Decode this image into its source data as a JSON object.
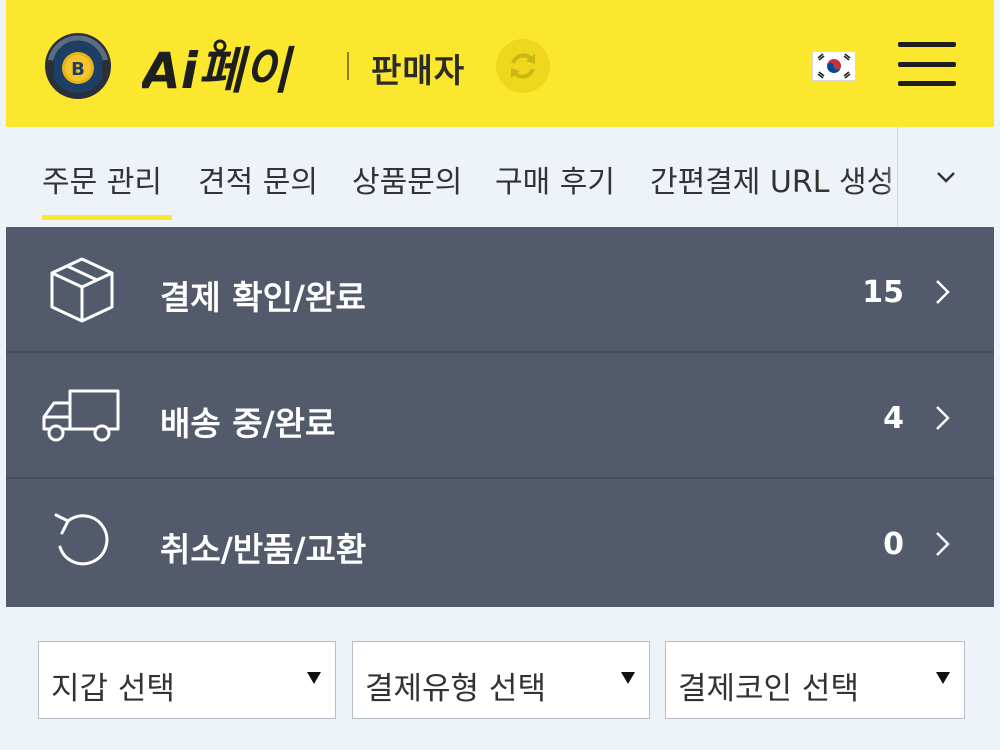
{
  "header": {
    "logo_text": "Ai페이",
    "role_label": "판매자",
    "icons": [
      "bitcoin-badge-icon",
      "refresh-icon",
      "korea-flag-icon",
      "hamburger-menu-icon"
    ]
  },
  "tabs": [
    {
      "label": "주문 관리",
      "active": true
    },
    {
      "label": "견적 문의",
      "active": false
    },
    {
      "label": "상품문의",
      "active": false
    },
    {
      "label": "구매 후기",
      "active": false
    },
    {
      "label": "간편결제 URL 생성",
      "active": false
    }
  ],
  "status_rows": [
    {
      "label": "결제 확인/완료",
      "count": "15",
      "icon": "box-icon"
    },
    {
      "label": "배송 중/완료",
      "count": "4",
      "icon": "truck-icon"
    },
    {
      "label": "취소/반품/교환",
      "count": "0",
      "icon": "undo-icon"
    }
  ],
  "filters": [
    {
      "label": "지갑 선택"
    },
    {
      "label": "결제유형 선택"
    },
    {
      "label": "결제코인 선택"
    }
  ],
  "colors": {
    "brand_yellow": "#fbe72d",
    "panel_slate": "#535a6b",
    "tab_bg": "#eef3fa",
    "logo_dark": "#2a2f3a",
    "logo_ring": "#1c3f63",
    "coin": "#e8b21b"
  }
}
